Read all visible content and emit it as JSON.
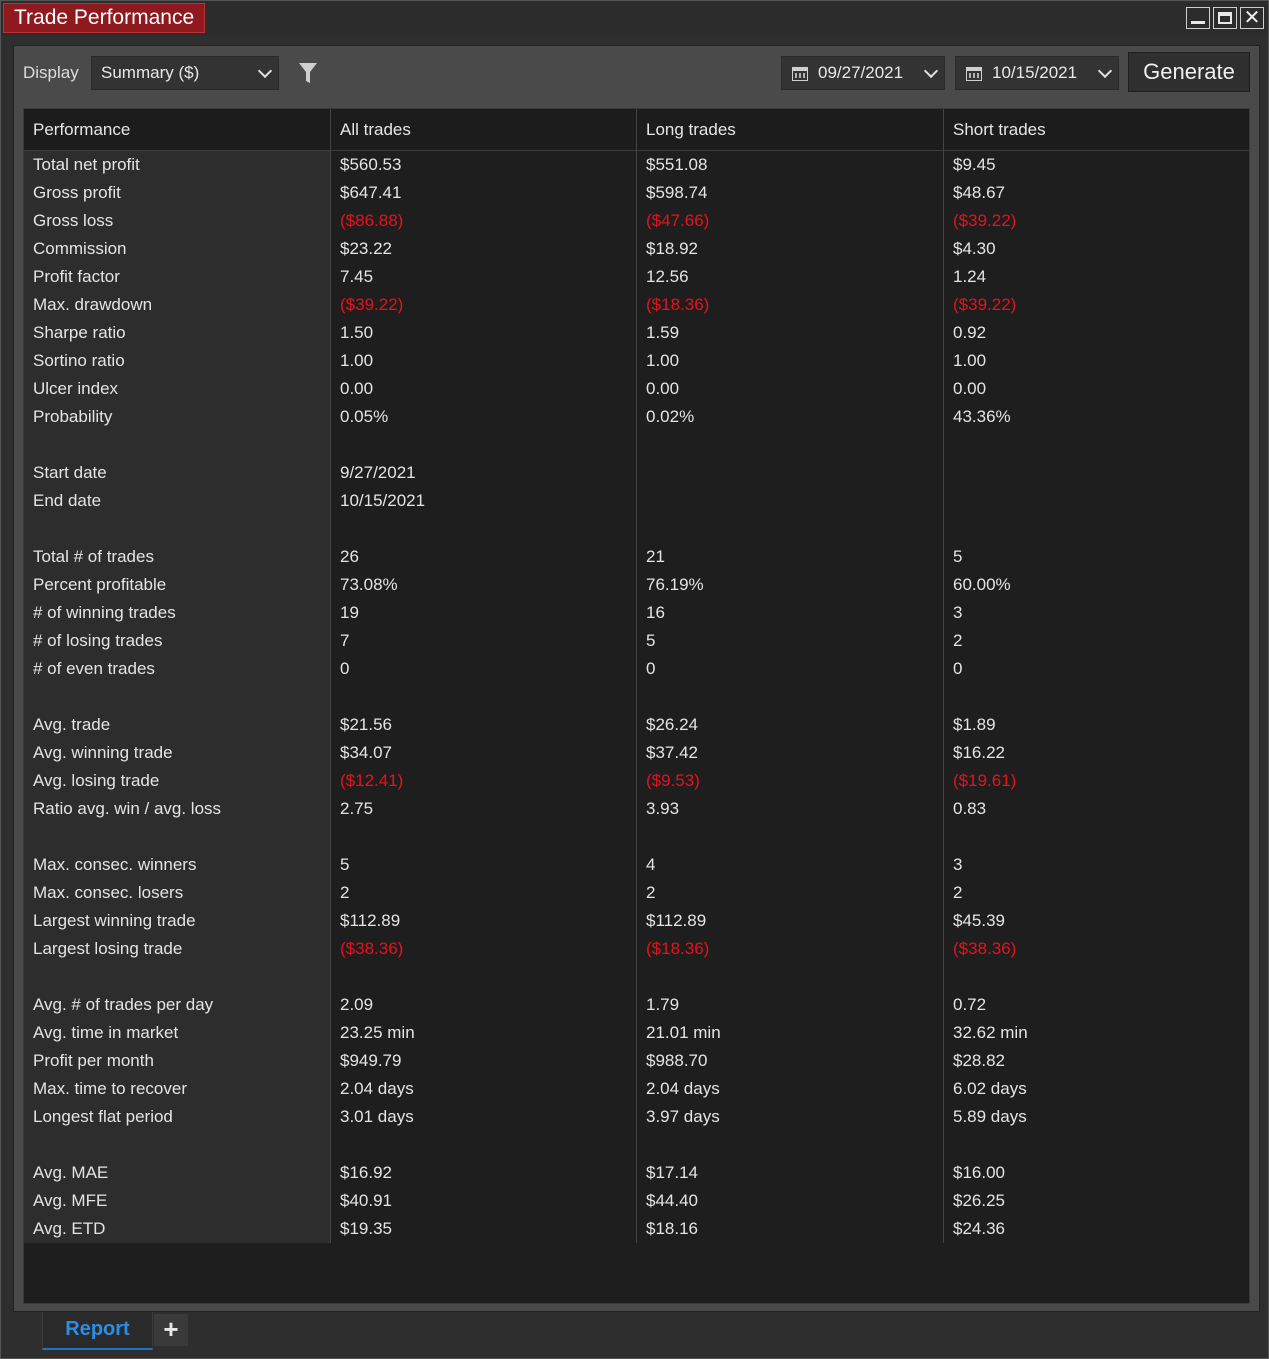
{
  "window": {
    "title": "Trade Performance"
  },
  "toolbar": {
    "display_label": "Display",
    "display_value": "Summary ($)",
    "start_date": "09/27/2021",
    "end_date": "10/15/2021",
    "generate_label": "Generate"
  },
  "grid": {
    "headers": [
      "Performance",
      "All trades",
      "Long trades",
      "Short trades"
    ],
    "rows": [
      {
        "label": "Total net profit",
        "all": "$560.53",
        "long": "$551.08",
        "short": "$9.45"
      },
      {
        "label": "Gross profit",
        "all": "$647.41",
        "long": "$598.74",
        "short": "$48.67"
      },
      {
        "label": "Gross loss",
        "all": "($86.88)",
        "long": "($47.66)",
        "short": "($39.22)",
        "negative": true
      },
      {
        "label": "Commission",
        "all": "$23.22",
        "long": "$18.92",
        "short": "$4.30"
      },
      {
        "label": "Profit factor",
        "all": "7.45",
        "long": "12.56",
        "short": "1.24"
      },
      {
        "label": "Max. drawdown",
        "all": "($39.22)",
        "long": "($18.36)",
        "short": "($39.22)",
        "negative": true
      },
      {
        "label": "Sharpe ratio",
        "all": "1.50",
        "long": "1.59",
        "short": "0.92"
      },
      {
        "label": "Sortino ratio",
        "all": "1.00",
        "long": "1.00",
        "short": "1.00"
      },
      {
        "label": "Ulcer index",
        "all": "0.00",
        "long": "0.00",
        "short": "0.00"
      },
      {
        "label": "Probability",
        "all": "0.05%",
        "long": "0.02%",
        "short": "43.36%"
      },
      {
        "spacer": true
      },
      {
        "label": "Start date",
        "all": "9/27/2021",
        "long": "",
        "short": ""
      },
      {
        "label": "End date",
        "all": "10/15/2021",
        "long": "",
        "short": ""
      },
      {
        "spacer": true
      },
      {
        "label": "Total # of trades",
        "all": "26",
        "long": "21",
        "short": "5"
      },
      {
        "label": "Percent profitable",
        "all": "73.08%",
        "long": "76.19%",
        "short": "60.00%"
      },
      {
        "label": "# of winning trades",
        "all": "19",
        "long": "16",
        "short": "3"
      },
      {
        "label": "# of losing trades",
        "all": "7",
        "long": "5",
        "short": "2"
      },
      {
        "label": "# of even trades",
        "all": "0",
        "long": "0",
        "short": "0"
      },
      {
        "spacer": true
      },
      {
        "label": "Avg. trade",
        "all": "$21.56",
        "long": "$26.24",
        "short": "$1.89"
      },
      {
        "label": "Avg. winning trade",
        "all": "$34.07",
        "long": "$37.42",
        "short": "$16.22"
      },
      {
        "label": "Avg. losing trade",
        "all": "($12.41)",
        "long": "($9.53)",
        "short": "($19.61)",
        "negative": true
      },
      {
        "label": "Ratio avg. win / avg. loss",
        "all": "2.75",
        "long": "3.93",
        "short": "0.83"
      },
      {
        "spacer": true
      },
      {
        "label": "Max. consec. winners",
        "all": "5",
        "long": "4",
        "short": "3"
      },
      {
        "label": "Max. consec. losers",
        "all": "2",
        "long": "2",
        "short": "2"
      },
      {
        "label": "Largest winning trade",
        "all": "$112.89",
        "long": "$112.89",
        "short": "$45.39"
      },
      {
        "label": "Largest losing trade",
        "all": "($38.36)",
        "long": "($18.36)",
        "short": "($38.36)",
        "negative": true
      },
      {
        "spacer": true
      },
      {
        "label": "Avg. # of trades per day",
        "all": "2.09",
        "long": "1.79",
        "short": "0.72"
      },
      {
        "label": "Avg. time in market",
        "all": "23.25 min",
        "long": "21.01 min",
        "short": "32.62 min"
      },
      {
        "label": "Profit per month",
        "all": "$949.79",
        "long": "$988.70",
        "short": "$28.82"
      },
      {
        "label": "Max. time to recover",
        "all": "2.04 days",
        "long": "2.04 days",
        "short": "6.02 days"
      },
      {
        "label": "Longest flat period",
        "all": "3.01 days",
        "long": "3.97 days",
        "short": "5.89 days"
      },
      {
        "spacer": true
      },
      {
        "label": "Avg. MAE",
        "all": "$16.92",
        "long": "$17.14",
        "short": "$16.00"
      },
      {
        "label": "Avg. MFE",
        "all": "$40.91",
        "long": "$44.40",
        "short": "$26.25"
      },
      {
        "label": "Avg. ETD",
        "all": "$19.35",
        "long": "$18.16",
        "short": "$24.36"
      }
    ]
  },
  "tabs": {
    "report_label": "Report",
    "add_label": "+"
  },
  "colors": {
    "title_accent": "#8e1a1f",
    "negative": "#e8111c",
    "tab_active": "#2a8ee8"
  },
  "icons": [
    "minimize-icon",
    "maximize-icon",
    "close-icon",
    "chevron-down-icon",
    "filter-icon",
    "calendar-icon"
  ]
}
